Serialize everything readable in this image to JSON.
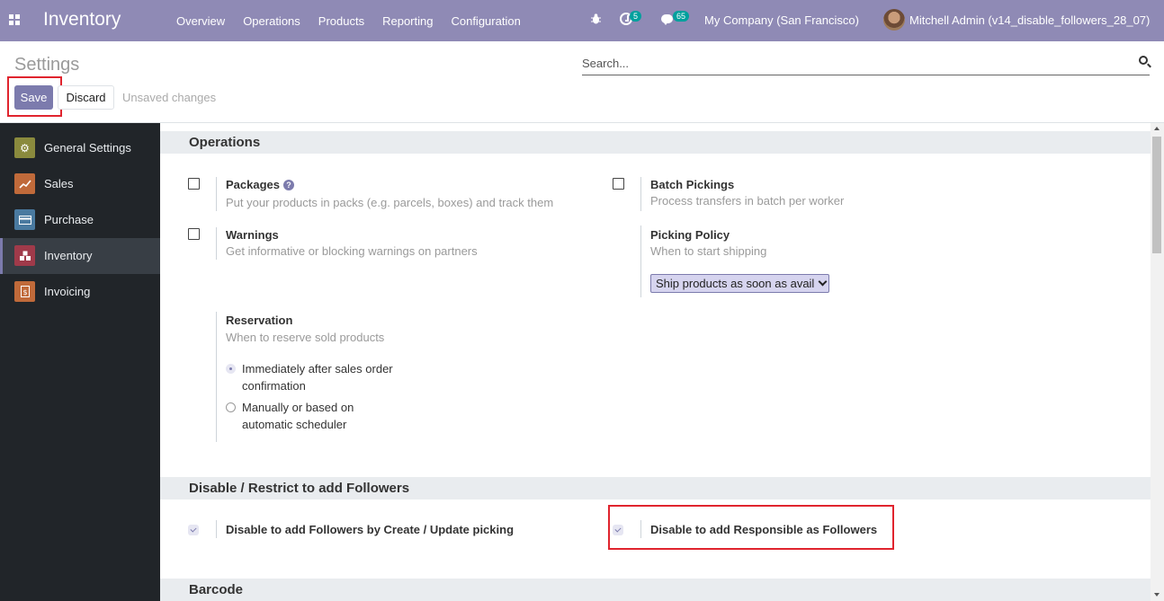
{
  "navbar": {
    "app_title": "Inventory",
    "menu": [
      "Overview",
      "Operations",
      "Products",
      "Reporting",
      "Configuration"
    ],
    "activity_count": "5",
    "message_count": "65",
    "company": "My Company (San Francisco)",
    "user": "Mitchell Admin (v14_disable_followers_28_07)",
    "color": "#8f8ab5"
  },
  "control_panel": {
    "title": "Settings",
    "search_placeholder": "Search...",
    "save_label": "Save",
    "discard_label": "Discard",
    "status": "Unsaved changes"
  },
  "sidebar": {
    "items": [
      {
        "label": "General Settings",
        "icon": "gear-icon",
        "color": "#8a8a3d"
      },
      {
        "label": "Sales",
        "icon": "chart-icon",
        "color": "#c06a3a"
      },
      {
        "label": "Purchase",
        "icon": "card-icon",
        "color": "#4a7aa0"
      },
      {
        "label": "Inventory",
        "icon": "boxes-icon",
        "color": "#a03a4a",
        "active": true
      },
      {
        "label": "Invoicing",
        "icon": "invoice-icon",
        "color": "#c06a3a"
      }
    ]
  },
  "sections": {
    "operations": {
      "title": "Operations",
      "packages": {
        "title": "Packages",
        "desc": "Put your products in packs (e.g. parcels, boxes) and track them",
        "checked": false
      },
      "batch_pickings": {
        "title": "Batch Pickings",
        "desc": "Process transfers in batch per worker",
        "checked": false
      },
      "warnings": {
        "title": "Warnings",
        "desc": "Get informative or blocking warnings on partners",
        "checked": false
      },
      "picking_policy": {
        "title": "Picking Policy",
        "desc": "When to start shipping",
        "selected": "Ship products as soon as avail"
      },
      "reservation": {
        "title": "Reservation",
        "desc": "When to reserve sold products",
        "options": [
          "Immediately after sales order confirmation",
          "Manually or based on automatic scheduler"
        ],
        "selected_index": 0
      }
    },
    "followers": {
      "title": "Disable / Restrict to add Followers",
      "create_update": {
        "title": "Disable to add Followers by Create / Update picking",
        "checked": true
      },
      "responsible": {
        "title": "Disable to add Responsible as Followers",
        "checked": true
      }
    },
    "barcode": {
      "title": "Barcode"
    }
  }
}
